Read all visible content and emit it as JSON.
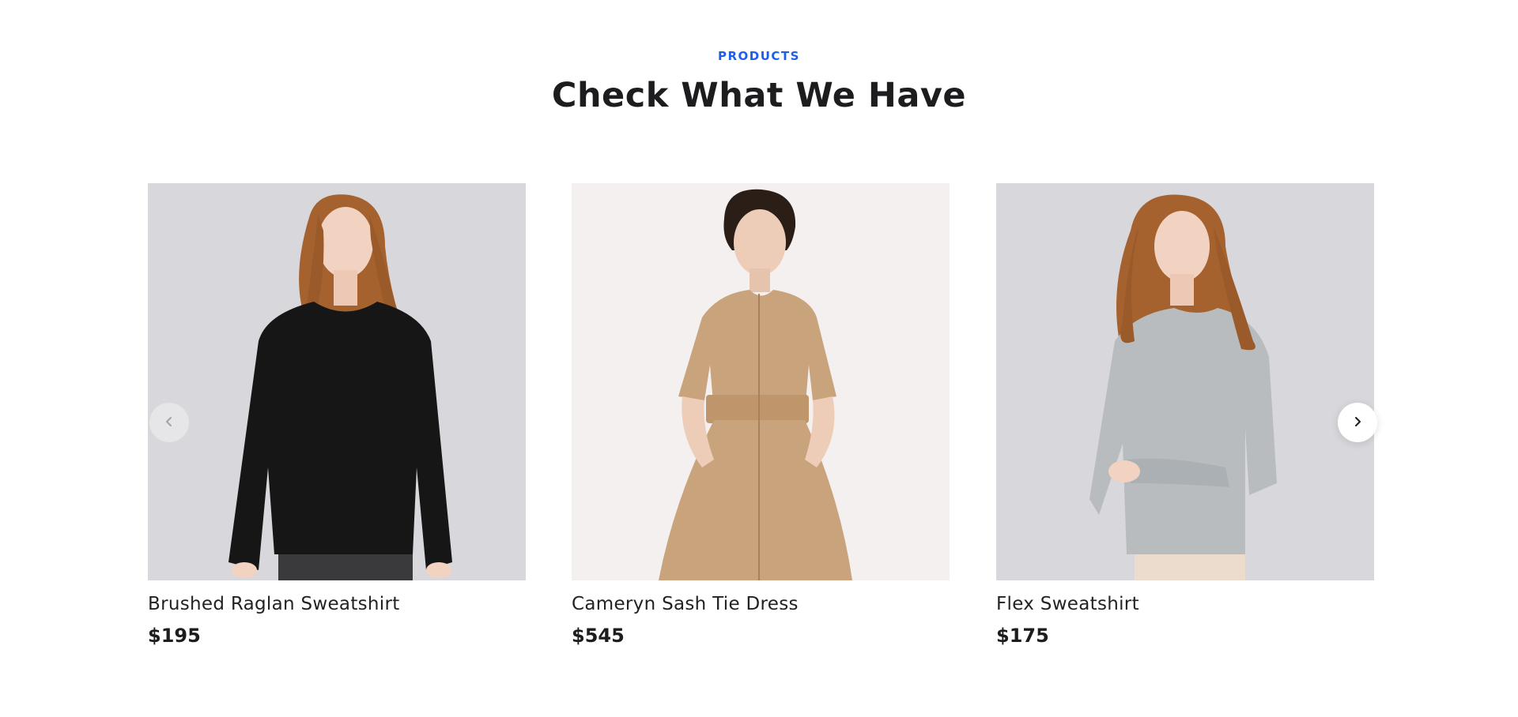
{
  "section": {
    "label": "PRODUCTS",
    "title": "Check What We Have"
  },
  "products": [
    {
      "name": "Brushed Raglan Sweatshirt",
      "price": "$195"
    },
    {
      "name": "Cameryn Sash Tie Dress",
      "price": "$545"
    },
    {
      "name": "Flex Sweatshirt",
      "price": "$175"
    }
  ],
  "carousel": {
    "prev_icon": "chevron-left-icon",
    "next_icon": "chevron-right-icon"
  },
  "colors": {
    "accent": "#1f5ee8",
    "text": "#1d1d1f",
    "photo_bg_grey": "#d8d8dc",
    "photo_bg_light": "#f3f0ef",
    "sweatshirt_black": "#161616",
    "dress_tan": "#c9a37b",
    "sweatshirt_grey": "#b8bcbf",
    "hair_auburn": "#a5622e",
    "skin": "#f2d3c2"
  }
}
